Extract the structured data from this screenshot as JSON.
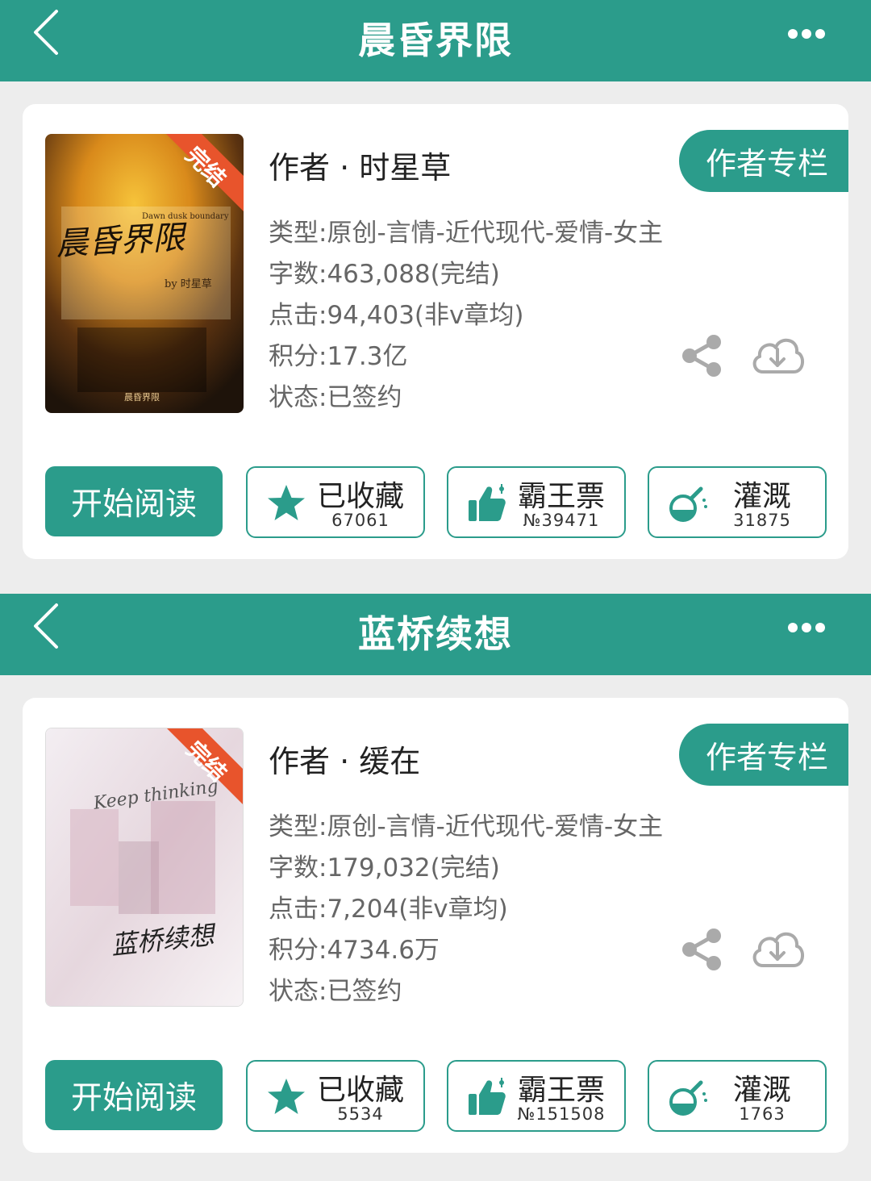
{
  "books": [
    {
      "title": "晨昏界限",
      "author": "作者 · 时星草",
      "author_column": "作者专栏",
      "badge": "完结",
      "cover_text": "晨昏界限",
      "cover_en": "Dawn dusk boundary",
      "cover_by": "by 时星草",
      "info": [
        "类型:原创-言情-近代现代-爱情-女主",
        "字数:463,088(完结)",
        "点击:94,403(非v章均)",
        "积分:17.3亿",
        "状态:已签约"
      ],
      "read_label": "开始阅读",
      "favorite": {
        "label": "已收藏",
        "count": "67061"
      },
      "vote": {
        "label": "霸王票",
        "count": "№39471"
      },
      "water": {
        "label": "灌溉",
        "count": "31875"
      }
    },
    {
      "title": "蓝桥续想",
      "author": "作者 · 缓在",
      "author_column": "作者专栏",
      "badge": "完结",
      "cover_text": "蓝桥续想",
      "cover_en": "Keep thinking",
      "info": [
        "类型:原创-言情-近代现代-爱情-女主",
        "字数:179,032(完结)",
        "点击:7,204(非v章均)",
        "积分:4734.6万",
        "状态:已签约"
      ],
      "read_label": "开始阅读",
      "favorite": {
        "label": "已收藏",
        "count": "5534"
      },
      "vote": {
        "label": "霸王票",
        "count": "№151508"
      },
      "water": {
        "label": "灌溉",
        "count": "1763"
      }
    }
  ],
  "colors": {
    "accent": "#2b9c8b",
    "badge": "#e8542c"
  }
}
